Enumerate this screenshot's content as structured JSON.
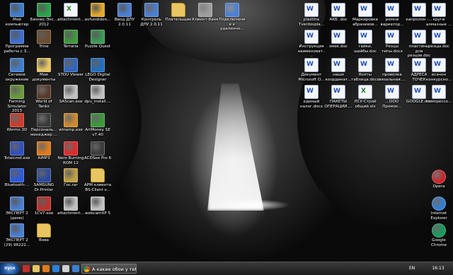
{
  "desktop": {
    "icons": [
      {
        "label": "Мой компьютер",
        "kind": "app",
        "color": "#3f7fd0"
      },
      {
        "label": "Биэнес-Экс... 2012",
        "kind": "app",
        "color": "#2aa34a"
      },
      {
        "label": "attachment...",
        "kind": "xls",
        "color": "#1e7c2a"
      },
      {
        "label": "avfundiden...",
        "kind": "app",
        "color": "#e0a92a"
      },
      {
        "label": "Ввод ДПУ 2.0.11",
        "kind": "app",
        "color": "#4a7fd4"
      },
      {
        "label": "Контроль ДПУ 2.0.11",
        "kind": "app",
        "color": "#4a7fd4"
      },
      {
        "label": "Плательщик",
        "kind": "folder",
        "color": "#e8c560"
      },
      {
        "label": "Клиент-банк",
        "kind": "app",
        "color": "#9e9e9e"
      },
      {
        "label": "Подключение к удаленно...",
        "kind": "app",
        "color": "#4a7fd4"
      },
      {
        "label": "Программа работы с 3...",
        "kind": "app",
        "color": "#3c6fd0"
      },
      {
        "label": "Trine",
        "kind": "app",
        "color": "#6e4c2e"
      },
      {
        "label": "Terraria",
        "kind": "app",
        "color": "#3d9a3d"
      },
      {
        "label": "Puzzle Quest",
        "kind": "app",
        "color": "#3a9a55"
      },
      {
        "label": "Сетевое окружение",
        "kind": "app",
        "color": "#3f7fd0"
      },
      {
        "label": "Мои документы",
        "kind": "app",
        "color": "#e8c560"
      },
      {
        "label": "STDU Viewer",
        "kind": "app",
        "color": "#2f66c0"
      },
      {
        "label": "LEGO Digital Designer",
        "kind": "app",
        "color": "#1f6fc4"
      },
      {
        "label": "Farming Simulator 2013",
        "kind": "app",
        "color": "#6a9a3a"
      },
      {
        "label": "World of Tanks",
        "kind": "app",
        "color": "#5a3a2a"
      },
      {
        "label": "SAScan.exe",
        "kind": "app",
        "color": "#c0c0c0"
      },
      {
        "label": "dpu_install....",
        "kind": "app",
        "color": "#c0c0c0"
      },
      {
        "label": "Worms 3D",
        "kind": "app",
        "color": "#d03a2a"
      },
      {
        "label": "Персональ... менеджер ...",
        "kind": "app",
        "color": "#3a3a3a"
      },
      {
        "label": "winamp.exe",
        "kind": "app",
        "color": "#d08a2a"
      },
      {
        "label": "ArtMoney SE v7.40",
        "kind": "app",
        "color": "#3a9a3a"
      },
      {
        "label": "Totalcmd.exe",
        "kind": "app",
        "color": "#2f4fc0"
      },
      {
        "label": "AIMP3",
        "kind": "app",
        "color": "#e07a1a"
      },
      {
        "label": "Nero Burning ROM 12",
        "kind": "app",
        "color": "#e02a2a"
      },
      {
        "label": "ACDSee Pro 6",
        "kind": "app",
        "color": "#3a3a3a"
      },
      {
        "label": "Bluetooth-...",
        "kind": "app",
        "color": "#2a5ae0"
      },
      {
        "label": "SAMSUNG Dr.Printer",
        "kind": "app",
        "color": "#2a4aa0"
      },
      {
        "label": "Гос.rar",
        "kind": "app",
        "color": "#c0a040"
      },
      {
        "label": "АРМ клиента BS-Client v...",
        "kind": "folder",
        "color": "#e8c560"
      },
      {
        "label": "ЭКСПЕРТ 2 (демо)",
        "kind": "app",
        "color": "#4a7fd4"
      },
      {
        "label": "1CV7.exe",
        "kind": "app",
        "color": "#c0302a"
      },
      {
        "label": "attachment...",
        "kind": "app",
        "color": "#c0c0c0"
      },
      {
        "label": "webcamXP 5",
        "kind": "app",
        "color": "#c0c0c0"
      },
      {
        "label": "ЭКСПЕРТ 2 (29) 96222...",
        "kind": "app",
        "color": "#4a7fd4"
      },
      {
        "label": "Вова",
        "kind": "folder",
        "color": "#e8c560"
      }
    ],
    "right_icons": [
      {
        "label": "plastina Tverdosplа...",
        "kind": "doc"
      },
      {
        "label": "АКБ .doc",
        "kind": "doc"
      },
      {
        "label": "Маркировка абразивов...",
        "kind": "doc"
      },
      {
        "label": "ремни вариатор...",
        "kind": "doc"
      },
      {
        "label": "капролон -...",
        "kind": "doc"
      },
      {
        "label": "круги алмазные ...",
        "kind": "doc"
      },
      {
        "label": "Инструкция наименоват...",
        "kind": "doc"
      },
      {
        "label": "эмек.doc",
        "kind": "doc"
      },
      {
        "label": "гайки, шайбы.doc",
        "kind": "doc"
      },
      {
        "label": "Резцы типы.docx",
        "kind": "doc"
      },
      {
        "label": "пластины для резцов.doc",
        "kind": "doc"
      },
      {
        "label": "резцы.doc",
        "kind": "doc"
      },
      {
        "label": "Документ Microsoft O...",
        "kind": "doc"
      },
      {
        "label": "наши координат...",
        "kind": "doc"
      },
      {
        "label": "болты таблица.docx",
        "kind": "doc"
      },
      {
        "label": "проволка вязальная....",
        "kind": "doc"
      },
      {
        "label": "АДРЕСА ТОЧЕК",
        "kind": "doc"
      },
      {
        "label": "есэнон конкурсно...",
        "kind": "doc"
      },
      {
        "label": "единый налог.docx",
        "kind": "doc"
      },
      {
        "label": "ПАКЕТЫ ОПЕРАЦИИ....",
        "kind": "doc"
      },
      {
        "label": "ЛСУ-Строй общий.xls",
        "kind": "xls"
      },
      {
        "label": "...ООО Промок...",
        "kind": "doc"
      },
      {
        "label": "GOOGLE.doc",
        "kind": "doc"
      },
      {
        "label": "компрессо...",
        "kind": "doc"
      },
      {
        "label": "Opera",
        "kind": "app"
      },
      {
        "label": "Internet Explorer",
        "kind": "app"
      },
      {
        "label": "Google Chrome",
        "kind": "app"
      }
    ]
  },
  "taskbar": {
    "start_label": "пуск",
    "active_task": "А какие обои у тебя ...",
    "language": "EN",
    "clock": "16:13",
    "colors": {
      "opera": "#d0232a",
      "ie": "#2f7fd8",
      "accent": "#1d4f9a"
    }
  }
}
